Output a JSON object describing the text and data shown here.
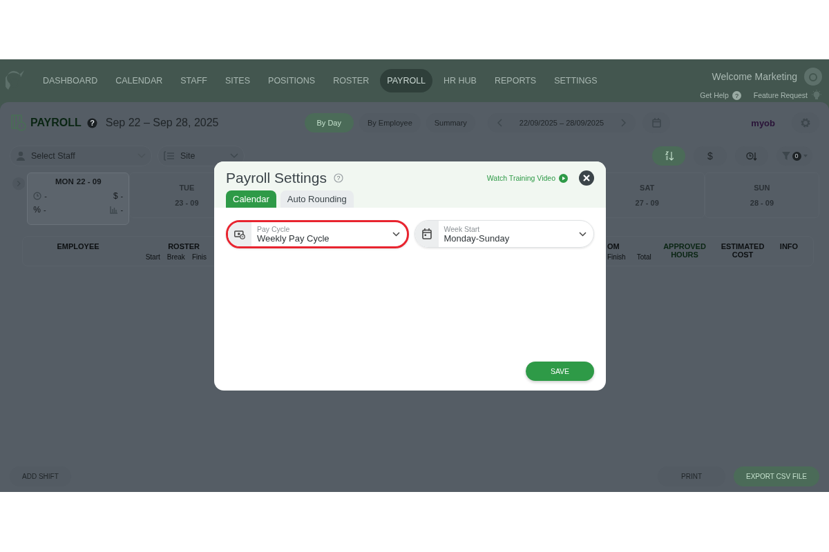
{
  "nav": {
    "items": [
      {
        "label": "DASHBOARD",
        "selected": false
      },
      {
        "label": "CALENDAR",
        "selected": false
      },
      {
        "label": "STAFF",
        "selected": false
      },
      {
        "label": "SITES",
        "selected": false
      },
      {
        "label": "POSITIONS",
        "selected": false
      },
      {
        "label": "ROSTER",
        "selected": false
      },
      {
        "label": "PAYROLL",
        "selected": true
      },
      {
        "label": "HR HUB",
        "selected": false
      },
      {
        "label": "REPORTS",
        "selected": false
      },
      {
        "label": "SETTINGS",
        "selected": false
      }
    ],
    "welcome": "Welcome Marketing",
    "links": [
      {
        "kind": "help",
        "label": "Get Help",
        "icon": "?"
      },
      {
        "kind": "idea",
        "label": "Feature Request"
      }
    ]
  },
  "page_header": {
    "title": "PAYROLL",
    "help_icon": "?",
    "date_range": "Sep 22 – Sep 28, 2025",
    "views": [
      {
        "label": "By Day",
        "selected": true
      },
      {
        "label": "By Employee",
        "selected": false
      },
      {
        "label": "Summary",
        "selected": false
      }
    ],
    "period": "22/09/2025 – 28/09/2025",
    "integration": "myob"
  },
  "filters": {
    "staff": {
      "placeholder": "Select Staff"
    },
    "site": {
      "placeholder": "Site"
    },
    "sort_buttons": [
      {
        "kind": "alpha",
        "selected": true
      },
      {
        "kind": "cost",
        "label": "$",
        "selected": false
      },
      {
        "kind": "time",
        "selected": false
      }
    ],
    "filter_count": "0"
  },
  "days": [
    {
      "weekday": "MON",
      "date": "22 - 09",
      "selected": true,
      "stats": [
        {
          "kind": "clock",
          "value": "-"
        },
        {
          "kind": "symbol",
          "symbol": "$",
          "value": "-"
        },
        {
          "kind": "symbol",
          "symbol": "%",
          "value": "-"
        },
        {
          "kind": "chart",
          "value": "-"
        }
      ]
    },
    {
      "weekday": "TUE",
      "date": "23 - 09",
      "selected": false
    },
    {
      "weekday": "SAT",
      "date": "27 - 09",
      "selected": false
    },
    {
      "weekday": "SUN",
      "date": "28 - 09",
      "selected": false
    }
  ],
  "table": {
    "left": [
      {
        "label": "EMPLOYEE"
      },
      {
        "label": "ROSTER",
        "sub": [
          "Start",
          "Break",
          "Finis"
        ]
      }
    ],
    "right": [
      {
        "label": "OM",
        "sub": [
          "Finish",
          "Total"
        ]
      },
      {
        "label": "APPROVED HOURS",
        "kind": "accent"
      },
      {
        "label": "ESTIMATED COST",
        "kind": "plain"
      },
      {
        "label": "INFO",
        "kind": "plain"
      }
    ]
  },
  "footer": [
    {
      "label": "ADD SHIFT",
      "kind": "plain"
    },
    {
      "label": "PRINT",
      "kind": "plain"
    },
    {
      "label": "EXPORT CSV FILE",
      "kind": "primary"
    }
  ],
  "modal": {
    "title": "Payroll Settings",
    "help_icon": "?",
    "video_link": "Watch Training Video",
    "tabs": [
      {
        "label": "Calendar",
        "selected": true
      },
      {
        "label": "Auto Rounding",
        "selected": false
      }
    ],
    "fields": [
      {
        "kind": "money",
        "label": "Pay Cycle",
        "value": "Weekly Pay Cycle",
        "highlighted": true
      },
      {
        "kind": "calendar",
        "label": "Week Start",
        "value": "Monday-Sunday",
        "highlighted": false
      }
    ],
    "save": "SAVE"
  }
}
